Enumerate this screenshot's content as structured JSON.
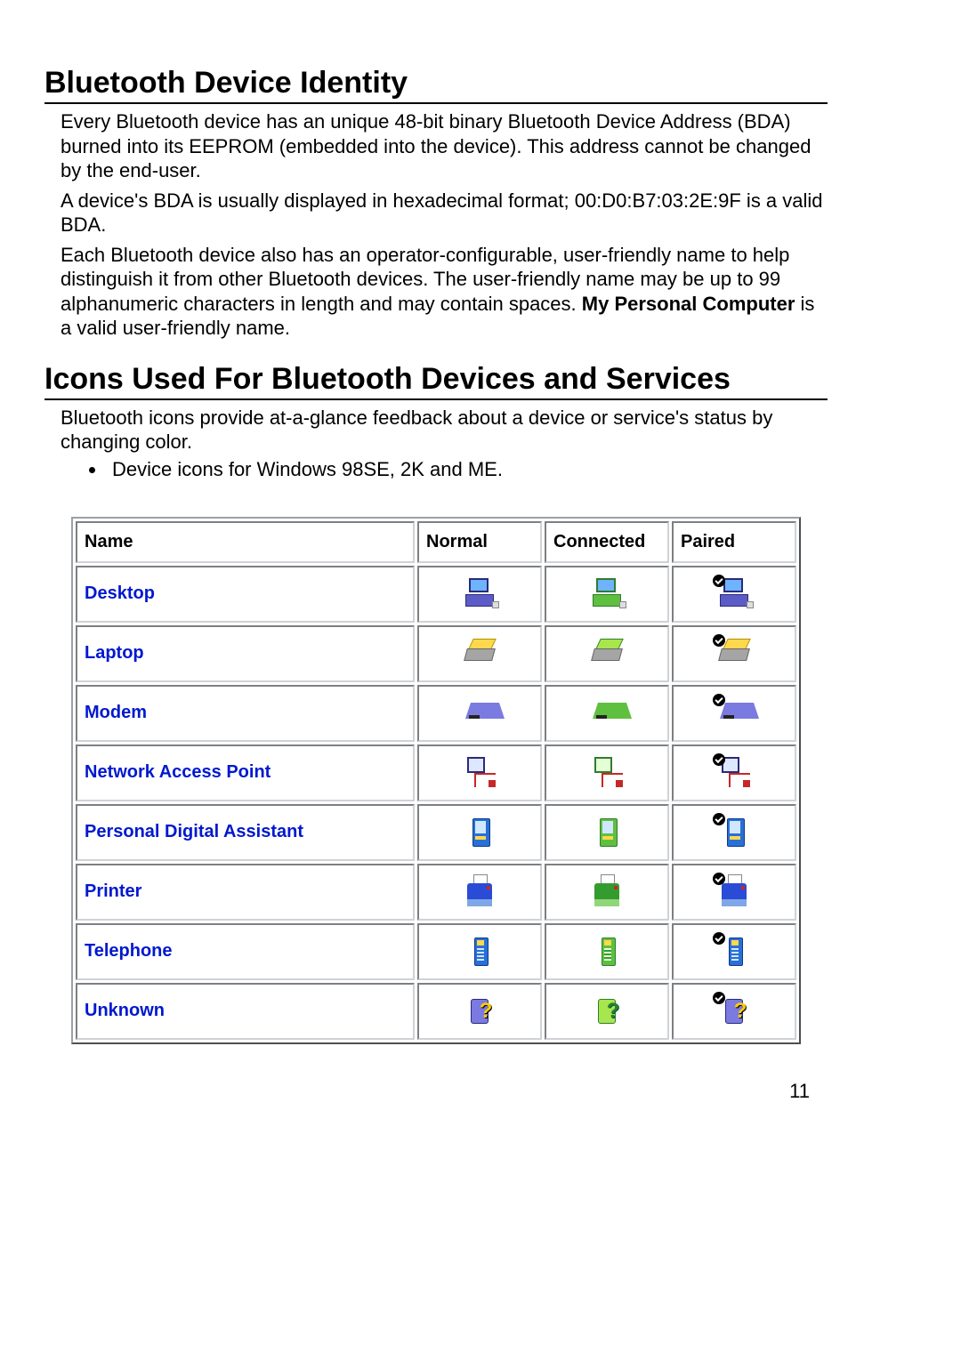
{
  "page_number": "11",
  "section1": {
    "title": "Bluetooth Device Identity",
    "para1": "Every Bluetooth device has an unique 48-bit binary Bluetooth Device Address (BDA) burned into its EEPROM (embedded into the device). This address cannot be changed by the end-user.",
    "para2": "A device's BDA is usually displayed in hexadecimal format; 00:D0:B7:03:2E:9F is a valid BDA.",
    "para3a": "Each Bluetooth device also has an operator-configurable, user-friendly name to help distinguish it from other Bluetooth devices. The user-friendly name may be up to 99 alphanumeric characters in length and may contain spaces. ",
    "para3b_bold": "My Personal Computer",
    "para3c": " is a valid user-friendly name."
  },
  "section2": {
    "title": "Icons Used For Bluetooth Devices and Services",
    "intro": "Bluetooth icons provide at-a-glance feedback about a device or service's status by changing color.",
    "bullet1": "Device icons for Windows 98SE, 2K and ME."
  },
  "table": {
    "headers": {
      "name": "Name",
      "normal": "Normal",
      "connected": "Connected",
      "paired": "Paired"
    },
    "rows": [
      {
        "name": "Desktop",
        "icon": "desktop"
      },
      {
        "name": "Laptop",
        "icon": "laptop"
      },
      {
        "name": "Modem",
        "icon": "modem"
      },
      {
        "name": "Network Access Point",
        "icon": "nap"
      },
      {
        "name": "Personal Digital Assistant",
        "icon": "pda"
      },
      {
        "name": "Printer",
        "icon": "printer"
      },
      {
        "name": "Telephone",
        "icon": "tel"
      },
      {
        "name": "Unknown",
        "icon": "unk"
      }
    ]
  }
}
